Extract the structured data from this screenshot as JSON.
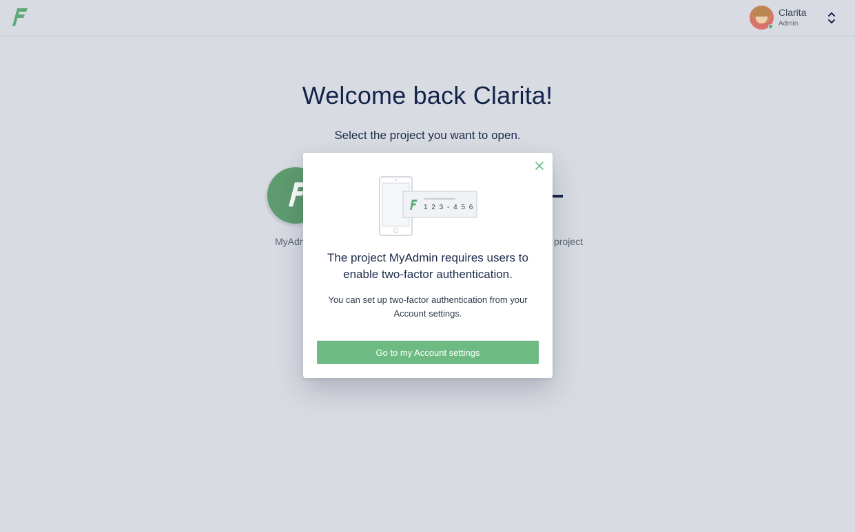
{
  "header": {
    "logo": "f-logo",
    "user": {
      "name": "Clarita",
      "role": "Admin",
      "status": "online"
    },
    "menu_icon": "chevron-up-down-icon"
  },
  "main": {
    "title": "Welcome back Clarita!",
    "subtitle": "Select the project you want to open.",
    "projects": [
      {
        "label": "MyAdm",
        "icon": "f-logo"
      },
      {
        "label": "w project",
        "icon": "plus-icon"
      }
    ]
  },
  "modal": {
    "close_icon": "close-icon",
    "illustration": {
      "logo": "f-logo",
      "code": "1 2 3 - 4 5 6"
    },
    "title": "The project MyAdmin requires users to enable two-factor authentication.",
    "text": "You can set up two-factor authentication from your Account settings.",
    "button_label": "Go to my Account settings"
  },
  "colors": {
    "accent": "#6dbb83",
    "brand_green": "#5e9c6f",
    "heading": "#13234a",
    "background": "#d8dbe2"
  }
}
